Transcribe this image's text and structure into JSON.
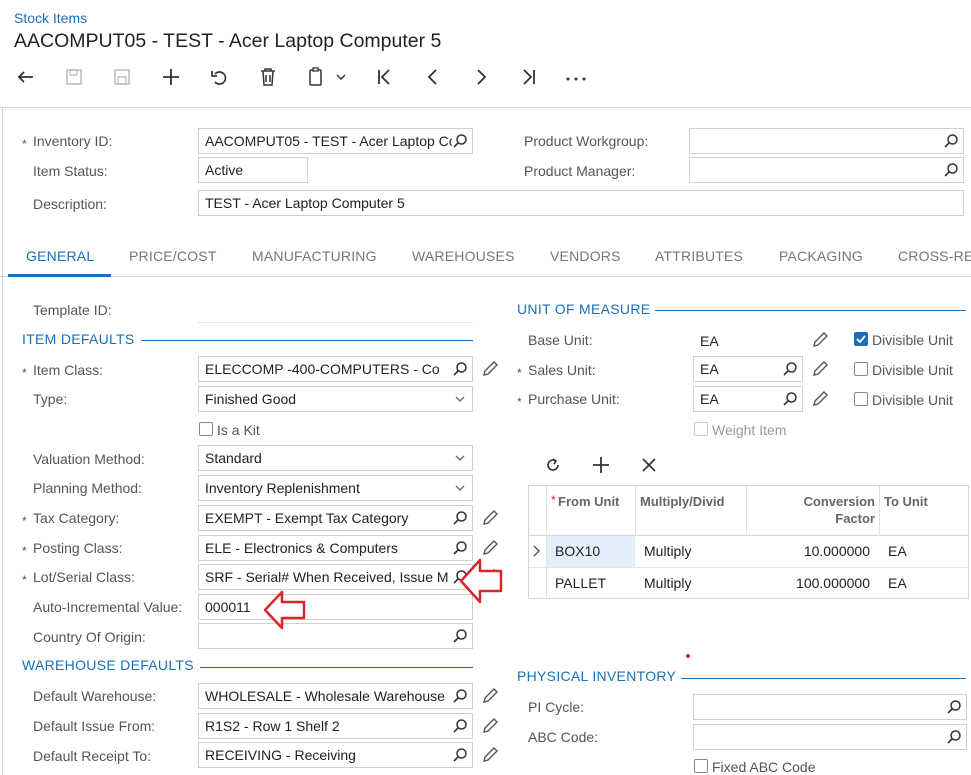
{
  "header": {
    "breadcrumb": "Stock Items",
    "title": "AACOMPUT05 - TEST - Acer Laptop Computer 5"
  },
  "toolbar": {
    "buttons": [
      "back-icon",
      "save-icon",
      "save-close-icon",
      "add-icon",
      "undo-icon",
      "delete-icon",
      "copy-paste-icon",
      "first-icon",
      "previous-icon",
      "next-icon",
      "last-icon",
      "more-icon"
    ]
  },
  "summary": {
    "inventory_id_label": "Inventory ID:",
    "inventory_id_value": "AACOMPUT05 - TEST - Acer Laptop Co",
    "item_status_label": "Item Status:",
    "item_status_value": "Active",
    "description_label": "Description:",
    "description_value": "TEST - Acer Laptop Computer 5",
    "product_workgroup_label": "Product Workgroup:",
    "product_workgroup_value": "",
    "product_manager_label": "Product Manager:",
    "product_manager_value": ""
  },
  "tabs": [
    "GENERAL",
    "PRICE/COST",
    "MANUFACTURING",
    "WAREHOUSES",
    "VENDORS",
    "ATTRIBUTES",
    "PACKAGING",
    "CROSS-RE"
  ],
  "general": {
    "template_id_label": "Template ID:",
    "item_defaults_title": "ITEM DEFAULTS",
    "item_class_label": "Item Class:",
    "item_class_value": "ELECCOMP  -400-COMPUTERS - Co",
    "type_label": "Type:",
    "type_value": "Finished Good",
    "is_kit_label": "Is a Kit",
    "valuation_method_label": "Valuation Method:",
    "valuation_method_value": "Standard",
    "planning_method_label": "Planning Method:",
    "planning_method_value": "Inventory Replenishment",
    "tax_category_label": "Tax Category:",
    "tax_category_value": "EXEMPT - Exempt Tax Category",
    "posting_class_label": "Posting Class:",
    "posting_class_value": "ELE - Electronics & Computers",
    "lot_serial_label": "Lot/Serial Class:",
    "lot_serial_value": "SRF - Serial# When Received, Issue M",
    "auto_incremental_label": "Auto-Incremental Value:",
    "auto_incremental_value": "000011",
    "country_label": "Country Of Origin:",
    "country_value": "",
    "warehouse_defaults_title": "WAREHOUSE DEFAULTS",
    "default_warehouse_label": "Default Warehouse:",
    "default_warehouse_value": "WHOLESALE - Wholesale Warehouse",
    "default_issue_label": "Default Issue From:",
    "default_issue_value": "R1S2 - Row 1 Shelf 2",
    "default_receipt_label": "Default Receipt To:",
    "default_receipt_value": "RECEIVING - Receiving"
  },
  "uom": {
    "title": "UNIT OF MEASURE",
    "base_unit_label": "Base Unit:",
    "base_unit_value": "EA",
    "sales_unit_label": "Sales Unit:",
    "sales_unit_value": "EA",
    "purchase_unit_label": "Purchase Unit:",
    "purchase_unit_value": "EA",
    "divisible_unit_label": "Divisible Unit",
    "weight_item_label": "Weight Item",
    "grid_headers": {
      "from_unit": "From Unit",
      "multiply_divide": "Multiply/Divid",
      "conversion_factor": "Conversion Factor",
      "to_unit": "To Unit"
    },
    "grid_rows": [
      {
        "from_unit": "BOX10",
        "multiply": "Multiply",
        "factor": "10.000000",
        "to_unit": "EA"
      },
      {
        "from_unit": "PALLET",
        "multiply": "Multiply",
        "factor": "100.000000",
        "to_unit": "EA"
      }
    ]
  },
  "physical_inventory": {
    "title": "PHYSICAL INVENTORY",
    "pi_cycle_label": "PI Cycle:",
    "pi_cycle_value": "",
    "abc_code_label": "ABC Code:",
    "abc_code_value": "",
    "fixed_abc_label": "Fixed ABC Code"
  },
  "colors": {
    "accent": "#1b6fb5",
    "annotation_arrow": "#d9252c",
    "selected_cell": "#e3eefb"
  }
}
